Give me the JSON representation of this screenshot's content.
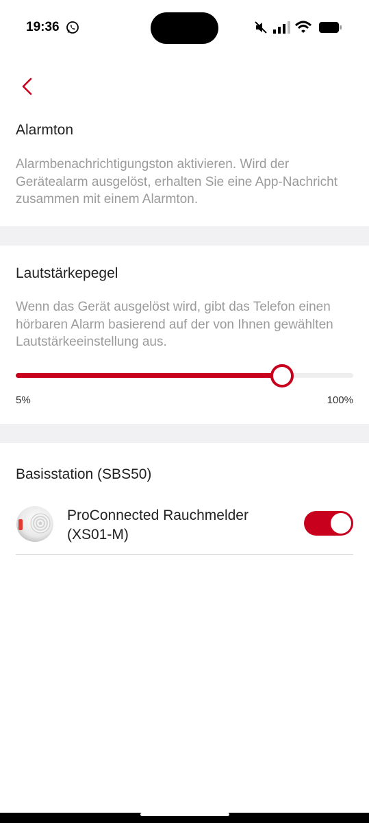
{
  "status_bar": {
    "time": "19:36",
    "icons": [
      "whatsapp-icon",
      "mute-icon",
      "signal-icon",
      "wifi-icon",
      "battery-icon"
    ]
  },
  "colors": {
    "accent": "#c8001e",
    "band": "#f1f1f3",
    "secondary_text": "#9b9b9b"
  },
  "alarm_tone": {
    "title": "Alarmton",
    "description": "Alarmbenachrichtigungston aktivieren. Wird der Gerätealarm ausgelöst, erhalten Sie eine App-Nachricht zusammen mit einem Alarmton."
  },
  "volume": {
    "title": "Lautstärkepegel",
    "description": "Wenn das Gerät ausgelöst wird, gibt das Telefon einen hörbaren Alarm basierend auf der von Ihnen gewählten Lautstärkeeinstellung aus.",
    "min_label": "5%",
    "max_label": "100%",
    "level_fraction": 0.79
  },
  "base_station": {
    "title": "Basisstation (SBS50)",
    "devices": [
      {
        "name": "ProConnected Rauchmelder (XS01-M)",
        "enabled": true
      }
    ]
  }
}
